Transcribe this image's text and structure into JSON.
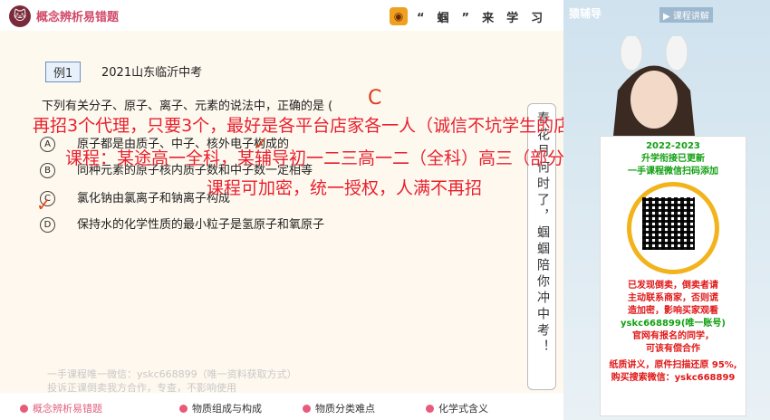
{
  "header": {
    "brand_icon": "🐱",
    "brand_title": "概念辨析易错题",
    "slogan_icon": "◉",
    "slogan": "“蝈”来学习"
  },
  "question": {
    "example_tag": "例1",
    "source": "2021山东临沂中考",
    "stem": "下列有关分子、原子、离子、元素的说法中，正确的是 (",
    "answer_mark": "C",
    "options": [
      {
        "letter": "A",
        "text": "原子都是由质子、中子、核外电子构成的"
      },
      {
        "letter": "B",
        "text": "同种元素的原子核内质子数和中子数一定相等"
      },
      {
        "letter": "C",
        "text": "氯化钠由氯离子和钠离子构成"
      },
      {
        "letter": "D",
        "text": "保持水的化学性质的最小粒子是氢原子和氧原子"
      }
    ]
  },
  "vertical_slogan": "春花月何时了，蝈蝈陪你冲中考！",
  "overlays": {
    "line1": "再招3个代理，只要3个，最好是各平台店家各一人（诚信不坑学生的店家）",
    "line2": "课程：某途高一全科，某辅导初一二三高一二（全科）高三（部分）",
    "line3": "课程可加密，统一授权，人满不再招"
  },
  "watermarks": [
    "一手课程唯一微信：yskc668899（唯一资料获取方式）",
    "投诉正课倒卖我方合作，专查，不影响使用"
  ],
  "bottom_nav": [
    "概念辨析易错题",
    "物质组成与构成",
    "物质分类难点",
    "化学式含义"
  ],
  "video": {
    "logo": "猿辅导",
    "tag": "▶ 课程讲解",
    "ad": {
      "year": "2022-2023",
      "line1": "升学衔接已更新",
      "line2": "一手课程微信扫码添加",
      "line3": "已发现倒卖，倒卖者请",
      "line4": "主动联系商家，否则谎",
      "line5": "造加密，影响买家观看",
      "line6": "yskc668899(唯一账号)",
      "line7": "官网有报名的同学，",
      "line8": "可该有偿合作",
      "line9": "纸质讲义，原件扫描还原 95%,",
      "line10": "购买搜索微信：yskc668899"
    }
  },
  "colors": {
    "overlay_red": "#e8202a",
    "brand_pink": "#d24a6a",
    "ad_green": "#12a012"
  }
}
